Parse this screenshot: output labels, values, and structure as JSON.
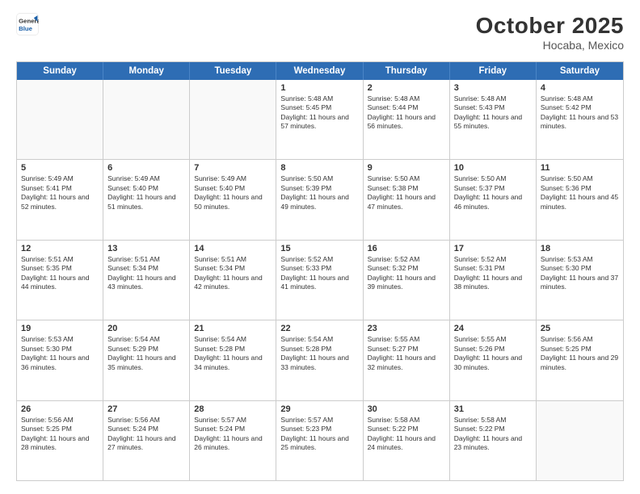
{
  "header": {
    "logo": {
      "general": "General",
      "blue": "Blue"
    },
    "title": "October 2025",
    "location": "Hocaba, Mexico"
  },
  "calendar": {
    "weekdays": [
      "Sunday",
      "Monday",
      "Tuesday",
      "Wednesday",
      "Thursday",
      "Friday",
      "Saturday"
    ],
    "rows": [
      [
        {
          "day": "",
          "info": ""
        },
        {
          "day": "",
          "info": ""
        },
        {
          "day": "",
          "info": ""
        },
        {
          "day": "1",
          "info": "Sunrise: 5:48 AM\nSunset: 5:45 PM\nDaylight: 11 hours and 57 minutes."
        },
        {
          "day": "2",
          "info": "Sunrise: 5:48 AM\nSunset: 5:44 PM\nDaylight: 11 hours and 56 minutes."
        },
        {
          "day": "3",
          "info": "Sunrise: 5:48 AM\nSunset: 5:43 PM\nDaylight: 11 hours and 55 minutes."
        },
        {
          "day": "4",
          "info": "Sunrise: 5:48 AM\nSunset: 5:42 PM\nDaylight: 11 hours and 53 minutes."
        }
      ],
      [
        {
          "day": "5",
          "info": "Sunrise: 5:49 AM\nSunset: 5:41 PM\nDaylight: 11 hours and 52 minutes."
        },
        {
          "day": "6",
          "info": "Sunrise: 5:49 AM\nSunset: 5:40 PM\nDaylight: 11 hours and 51 minutes."
        },
        {
          "day": "7",
          "info": "Sunrise: 5:49 AM\nSunset: 5:40 PM\nDaylight: 11 hours and 50 minutes."
        },
        {
          "day": "8",
          "info": "Sunrise: 5:50 AM\nSunset: 5:39 PM\nDaylight: 11 hours and 49 minutes."
        },
        {
          "day": "9",
          "info": "Sunrise: 5:50 AM\nSunset: 5:38 PM\nDaylight: 11 hours and 47 minutes."
        },
        {
          "day": "10",
          "info": "Sunrise: 5:50 AM\nSunset: 5:37 PM\nDaylight: 11 hours and 46 minutes."
        },
        {
          "day": "11",
          "info": "Sunrise: 5:50 AM\nSunset: 5:36 PM\nDaylight: 11 hours and 45 minutes."
        }
      ],
      [
        {
          "day": "12",
          "info": "Sunrise: 5:51 AM\nSunset: 5:35 PM\nDaylight: 11 hours and 44 minutes."
        },
        {
          "day": "13",
          "info": "Sunrise: 5:51 AM\nSunset: 5:34 PM\nDaylight: 11 hours and 43 minutes."
        },
        {
          "day": "14",
          "info": "Sunrise: 5:51 AM\nSunset: 5:34 PM\nDaylight: 11 hours and 42 minutes."
        },
        {
          "day": "15",
          "info": "Sunrise: 5:52 AM\nSunset: 5:33 PM\nDaylight: 11 hours and 41 minutes."
        },
        {
          "day": "16",
          "info": "Sunrise: 5:52 AM\nSunset: 5:32 PM\nDaylight: 11 hours and 39 minutes."
        },
        {
          "day": "17",
          "info": "Sunrise: 5:52 AM\nSunset: 5:31 PM\nDaylight: 11 hours and 38 minutes."
        },
        {
          "day": "18",
          "info": "Sunrise: 5:53 AM\nSunset: 5:30 PM\nDaylight: 11 hours and 37 minutes."
        }
      ],
      [
        {
          "day": "19",
          "info": "Sunrise: 5:53 AM\nSunset: 5:30 PM\nDaylight: 11 hours and 36 minutes."
        },
        {
          "day": "20",
          "info": "Sunrise: 5:54 AM\nSunset: 5:29 PM\nDaylight: 11 hours and 35 minutes."
        },
        {
          "day": "21",
          "info": "Sunrise: 5:54 AM\nSunset: 5:28 PM\nDaylight: 11 hours and 34 minutes."
        },
        {
          "day": "22",
          "info": "Sunrise: 5:54 AM\nSunset: 5:28 PM\nDaylight: 11 hours and 33 minutes."
        },
        {
          "day": "23",
          "info": "Sunrise: 5:55 AM\nSunset: 5:27 PM\nDaylight: 11 hours and 32 minutes."
        },
        {
          "day": "24",
          "info": "Sunrise: 5:55 AM\nSunset: 5:26 PM\nDaylight: 11 hours and 30 minutes."
        },
        {
          "day": "25",
          "info": "Sunrise: 5:56 AM\nSunset: 5:25 PM\nDaylight: 11 hours and 29 minutes."
        }
      ],
      [
        {
          "day": "26",
          "info": "Sunrise: 5:56 AM\nSunset: 5:25 PM\nDaylight: 11 hours and 28 minutes."
        },
        {
          "day": "27",
          "info": "Sunrise: 5:56 AM\nSunset: 5:24 PM\nDaylight: 11 hours and 27 minutes."
        },
        {
          "day": "28",
          "info": "Sunrise: 5:57 AM\nSunset: 5:24 PM\nDaylight: 11 hours and 26 minutes."
        },
        {
          "day": "29",
          "info": "Sunrise: 5:57 AM\nSunset: 5:23 PM\nDaylight: 11 hours and 25 minutes."
        },
        {
          "day": "30",
          "info": "Sunrise: 5:58 AM\nSunset: 5:22 PM\nDaylight: 11 hours and 24 minutes."
        },
        {
          "day": "31",
          "info": "Sunrise: 5:58 AM\nSunset: 5:22 PM\nDaylight: 11 hours and 23 minutes."
        },
        {
          "day": "",
          "info": ""
        }
      ]
    ]
  }
}
